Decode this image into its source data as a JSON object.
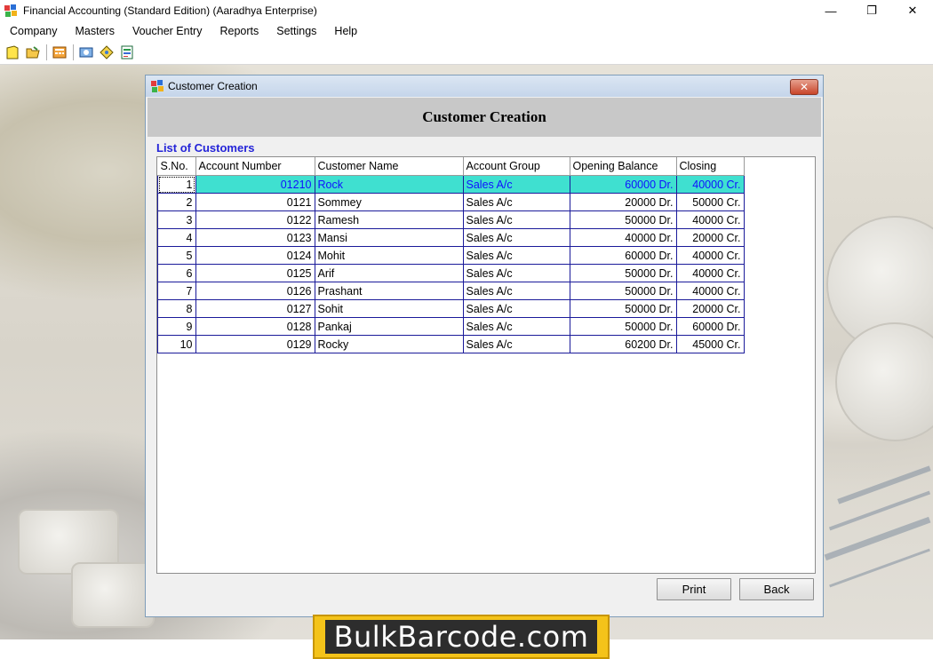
{
  "window": {
    "title": "Financial Accounting (Standard Edition) (Aaradhya Enterprise)",
    "minimize_glyph": "—",
    "maximize_glyph": "❐",
    "close_glyph": "✕"
  },
  "menu": [
    {
      "label": "Company"
    },
    {
      "label": "Masters"
    },
    {
      "label": "Voucher Entry"
    },
    {
      "label": "Reports"
    },
    {
      "label": "Settings"
    },
    {
      "label": "Help"
    }
  ],
  "toolbar": {
    "icons": [
      "new-document-icon",
      "open-folder-icon",
      "calculator-icon",
      "voucher-icon",
      "diamond-icon",
      "report-icon"
    ]
  },
  "dialog": {
    "title": "Customer Creation",
    "header": "Customer Creation",
    "close_glyph": "✕",
    "list_label": "List of Customers",
    "columns": [
      "S.No.",
      "Account Number",
      "Customer Name",
      "Account Group",
      "Opening Balance",
      "Closing"
    ],
    "rows": [
      {
        "sno": "1",
        "account": "01210",
        "name": "Rock",
        "group": "Sales A/c",
        "opening": "60000 Dr.",
        "closing": "40000 Cr."
      },
      {
        "sno": "2",
        "account": "0121",
        "name": "Sommey",
        "group": "Sales A/c",
        "opening": "20000 Dr.",
        "closing": "50000 Cr."
      },
      {
        "sno": "3",
        "account": "0122",
        "name": "Ramesh",
        "group": "Sales A/c",
        "opening": "50000 Dr.",
        "closing": "40000 Cr."
      },
      {
        "sno": "4",
        "account": "0123",
        "name": "Mansi",
        "group": "Sales A/c",
        "opening": "40000 Dr.",
        "closing": "20000 Cr."
      },
      {
        "sno": "5",
        "account": "0124",
        "name": "Mohit",
        "group": "Sales A/c",
        "opening": "60000 Dr.",
        "closing": "40000 Cr."
      },
      {
        "sno": "6",
        "account": "0125",
        "name": "Arif",
        "group": "Sales A/c",
        "opening": "50000 Dr.",
        "closing": "40000 Cr."
      },
      {
        "sno": "7",
        "account": "0126",
        "name": "Prashant",
        "group": "Sales A/c",
        "opening": "50000 Dr.",
        "closing": "40000 Cr."
      },
      {
        "sno": "8",
        "account": "0127",
        "name": "Sohit",
        "group": "Sales A/c",
        "opening": "50000 Dr.",
        "closing": "20000 Cr."
      },
      {
        "sno": "9",
        "account": "0128",
        "name": "Pankaj",
        "group": "Sales A/c",
        "opening": "50000 Dr.",
        "closing": "60000 Dr."
      },
      {
        "sno": "10",
        "account": "0129",
        "name": "Rocky",
        "group": "Sales A/c",
        "opening": "60200 Dr.",
        "closing": "45000 Cr."
      }
    ],
    "selected_row": 0,
    "buttons": {
      "print": "Print",
      "back": "Back"
    }
  },
  "watermark": {
    "text": "BulkBarcode.com"
  },
  "colors": {
    "selected_row": "#3fe0d0",
    "selected_text": "#1010ff",
    "list_label": "#2424d8",
    "banner": "#f4c31a"
  }
}
